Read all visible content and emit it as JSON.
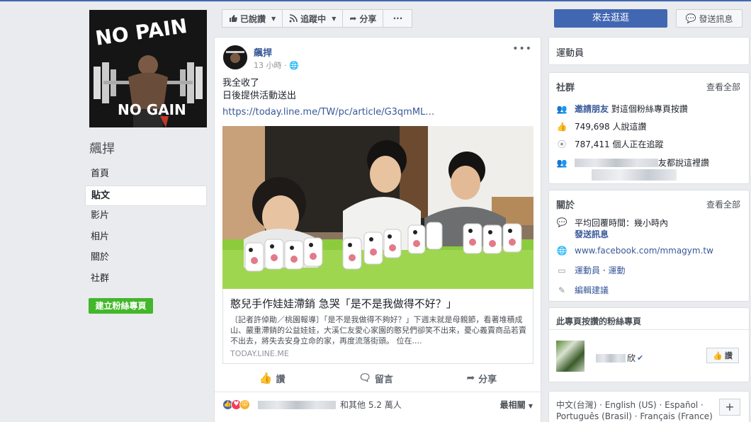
{
  "page": {
    "name": "飆捍",
    "cover_text_top": "NO PAIN",
    "cover_text_bottom": "NO GAIN"
  },
  "nav": [
    "首頁",
    "貼文",
    "影片",
    "相片",
    "關於",
    "社群"
  ],
  "create_page": "建立粉絲專頁",
  "actions": {
    "liked": "已說讚",
    "following": "追蹤中",
    "share": "分享",
    "more": "···"
  },
  "header": {
    "visit": "來去逛逛",
    "message": "發送訊息"
  },
  "post": {
    "author": "飆捍",
    "time": "13 小時",
    "line1": "我全收了",
    "line2": "日後提供活動送出",
    "link": "https://today.line.me/TW/pc/article/G3qmML…",
    "link_title": "憨兒手作娃娃滯銷 急哭「是不是我做得不好？」",
    "link_desc": "〔記者許倬勛／桃園報導〕「是不是我做得不夠好？」下週末就是母親節，看著堆積成山、嚴重滯銷的公益娃娃，大溪仁友愛心家園的憨兒們卻笑不出來，憂心義賣商品若賣不出去，將失去安身立命的家，再度流落街頭。 位在....",
    "link_source": "TODAY.LINE.ME",
    "act_like": "讚",
    "act_comment": "留言",
    "act_share": "分享",
    "reactions_text": "和其他 5.2 萬人",
    "sort": "最相關"
  },
  "category": "運動員",
  "community": {
    "title": "社群",
    "see_all": "查看全部",
    "invite": "邀請朋友",
    "invite_suffix": "對這個粉絲專頁按讚",
    "likes": "749,698 人說這讚",
    "follows": "787,411 個人正在追蹤",
    "friends_suffix": "友都說這裡讚"
  },
  "about": {
    "title": "關於",
    "see_all": "查看全部",
    "response": "平均回覆時間：幾小時內",
    "send_msg": "發送訊息",
    "website": "www.facebook.com/mmagym.tw",
    "cat_a": "運動員",
    "cat_b": "運動",
    "edit": "編輯建議"
  },
  "liked_pages": {
    "title": "此專頁按讚的粉絲專頁",
    "page_suffix": "欣",
    "like_btn": "讚"
  },
  "languages": {
    "line1": "中文(台灣) · English (US) · Español ·",
    "line2": "Português (Brasil) · Français (France)",
    "add": "+"
  }
}
